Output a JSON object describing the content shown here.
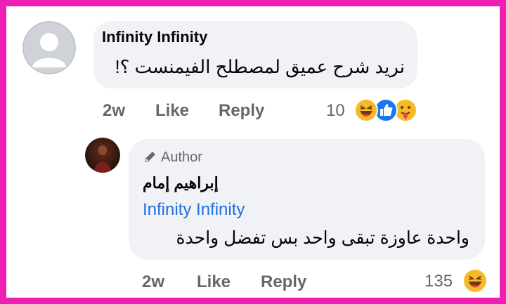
{
  "comment": {
    "author": "Infinity Infinity",
    "text": "نريد شرح عميق لمصطلح الفيمنست ؟!",
    "time": "2w",
    "like_label": "Like",
    "reply_label": "Reply",
    "reaction_count": "10",
    "reactions": [
      "haha-reaction-icon",
      "like-reaction-icon",
      "care-reaction-icon"
    ]
  },
  "reply": {
    "badge_label": "Author",
    "badge_icon": "pencil-icon",
    "author": "إبراهيم إمام",
    "mention": "Infinity Infinity",
    "text": "واحدة عاوزة تبقى واحد بس تفضل واحدة",
    "time": "2w",
    "like_label": "Like",
    "reply_label": "Reply",
    "reaction_count": "135",
    "reactions": [
      "haha-reaction-icon"
    ]
  },
  "colors": {
    "frame": "#f01fb4",
    "bubble": "#f0f2f5",
    "mention": "#216fdb",
    "secondary_text": "#65676b",
    "like_blue": "#1877f2",
    "haha_yellow": "#f7b928"
  }
}
